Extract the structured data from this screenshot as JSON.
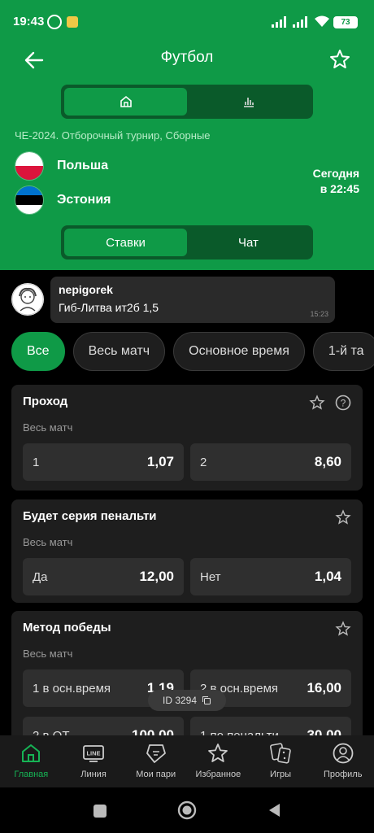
{
  "status": {
    "time": "19:43",
    "battery": "73"
  },
  "header": {
    "title": "Футбол",
    "back_icon": "arrow-left-icon",
    "fav_icon": "star-outline-icon"
  },
  "view_tabs": [
    {
      "icon": "home-icon",
      "active": true
    },
    {
      "icon": "bar-chart-icon",
      "active": false
    }
  ],
  "match": {
    "league": "ЧЕ-2024. Отборочный турнир, Сборные",
    "team1": "Польша",
    "team2": "Эстония",
    "date": "Сегодня",
    "time": "в 22:45"
  },
  "content_tabs": [
    {
      "label": "Ставки",
      "active": true
    },
    {
      "label": "Чат",
      "active": false
    }
  ],
  "chat": {
    "user": "nepigorek",
    "message": "Гиб-Литва ит2б 1,5",
    "time": "15:23"
  },
  "filters": [
    "Все",
    "Весь матч",
    "Основное время",
    "1-й та"
  ],
  "markets": [
    {
      "title": "Проход",
      "period": "Весь матч",
      "odds": [
        {
          "label": "1",
          "value": "1,07"
        },
        {
          "label": "2",
          "value": "8,60"
        }
      ]
    },
    {
      "title": "Будет серия пенальти",
      "period": "Весь матч",
      "odds": [
        {
          "label": "Да",
          "value": "12,00"
        },
        {
          "label": "Нет",
          "value": "1,04"
        }
      ]
    },
    {
      "title": "Метод победы",
      "period": "Весь матч",
      "odds": [
        {
          "label": "1 в осн.время",
          "value": "1,19"
        },
        {
          "label": "2 в осн.время",
          "value": "16,00"
        }
      ],
      "odds2": [
        {
          "label": "2 в ОТ",
          "value": "100,00"
        },
        {
          "label": "1 по пенальти",
          "value": "30,00"
        }
      ]
    }
  ],
  "id_badge": "ID 3294",
  "nav": [
    {
      "label": "Главная",
      "icon": "home-icon",
      "active": true
    },
    {
      "label": "Линия",
      "icon": "line-icon",
      "active": false
    },
    {
      "label": "Мои пари",
      "icon": "ticket-icon",
      "active": false
    },
    {
      "label": "Избранное",
      "icon": "star-icon",
      "active": false
    },
    {
      "label": "Игры",
      "icon": "dice-icon",
      "active": false
    },
    {
      "label": "Профиль",
      "icon": "profile-icon",
      "active": false
    }
  ],
  "line_icon_text": "LINE",
  "colors": {
    "brand": "#0f9a47",
    "background": "#000000",
    "card": "#1e1e1e"
  }
}
